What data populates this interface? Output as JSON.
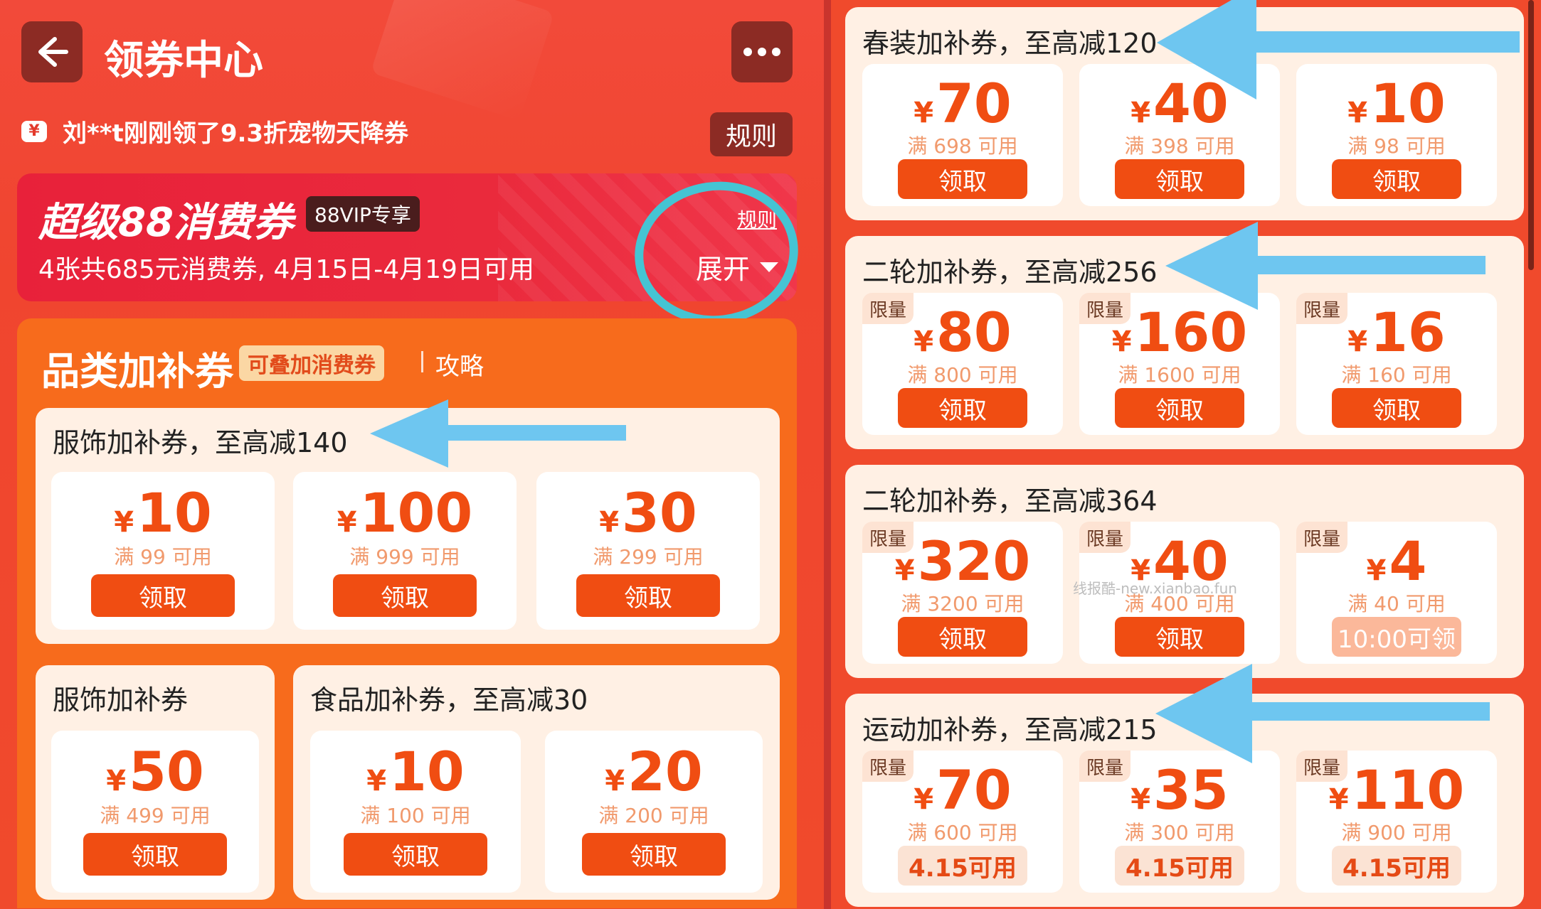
{
  "header": {
    "title": "领券中心",
    "ticker_icon": "¥",
    "ticker": "刘**t刚刚领了9.3折宠物天降券",
    "rules_label": "规则"
  },
  "vip": {
    "title": "超级88消费券",
    "badge": "88VIP专享",
    "desc": "4张共685元消费券, 4月15日-4月19日可用",
    "rules_link": "规则",
    "expand_label": "展开"
  },
  "category": {
    "title": "品类加补券",
    "badge": "可叠加消费券",
    "guide": "攻略"
  },
  "currency": "¥",
  "limit_label": "限量",
  "groups_left": [
    {
      "title": "服饰加补券，至高减140",
      "coupons": [
        {
          "amount": "10",
          "cond": "满 99 可用",
          "btn": "领取"
        },
        {
          "amount": "100",
          "cond": "满 999 可用",
          "btn": "领取"
        },
        {
          "amount": "30",
          "cond": "满 299 可用",
          "btn": "领取"
        }
      ]
    },
    {
      "title": "服饰加补券",
      "coupons": [
        {
          "amount": "50",
          "cond": "满 499 可用",
          "btn": "领取"
        }
      ]
    },
    {
      "title": "食品加补券，至高减30",
      "coupons": [
        {
          "amount": "10",
          "cond": "满 100 可用",
          "btn": "领取"
        },
        {
          "amount": "20",
          "cond": "满 200 可用",
          "btn": "领取"
        }
      ]
    }
  ],
  "groups_right": [
    {
      "title": "春装加补券，至高减120",
      "coupons": [
        {
          "amount": "70",
          "cond": "满 698 可用",
          "btn": "领取"
        },
        {
          "amount": "40",
          "cond": "满 398 可用",
          "btn": "领取"
        },
        {
          "amount": "10",
          "cond": "满 98 可用",
          "btn": "领取"
        }
      ]
    },
    {
      "title": "二轮加补券，至高减256",
      "coupons": [
        {
          "amount": "80",
          "cond": "满 800 可用",
          "btn": "领取"
        },
        {
          "amount": "160",
          "cond": "满 1600 可用",
          "btn": "领取"
        },
        {
          "amount": "16",
          "cond": "满 160 可用",
          "btn": "领取"
        }
      ]
    },
    {
      "title": "二轮加补券，至高减364",
      "coupons": [
        {
          "amount": "320",
          "cond": "满 3200 可用",
          "btn": "领取"
        },
        {
          "amount": "40",
          "cond": "满 400 可用",
          "btn": "领取"
        },
        {
          "amount": "4",
          "cond": "满 40 可用",
          "btn": "10:00可领"
        }
      ]
    },
    {
      "title": "运动加补券，至高减215",
      "coupons": [
        {
          "amount": "70",
          "cond": "满 600 可用",
          "btn": "4.15可用"
        },
        {
          "amount": "35",
          "cond": "满 300 可用",
          "btn": "4.15可用"
        },
        {
          "amount": "110",
          "cond": "满 900 可用",
          "btn": "4.15可用"
        }
      ]
    }
  ],
  "watermark": "线报酷-new.xianbao.fun",
  "colors": {
    "page_red": "#f04a2c",
    "accent_orange": "#f04d12",
    "panel_orange": "#f76b1c",
    "annotation_blue": "#6ec6f0",
    "annotation_circle": "#45c4d3"
  }
}
